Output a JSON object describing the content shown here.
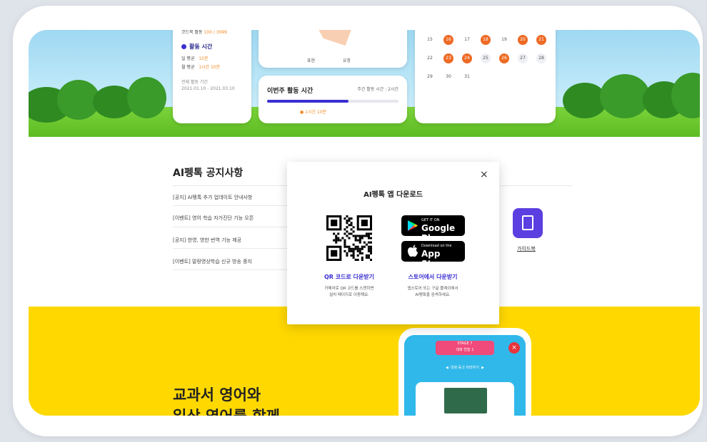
{
  "summary_card": {
    "top_row_label": "코드북 활동",
    "top_row_value": "100 / 3999",
    "section_title": "활동 시간",
    "daily_avg_label": "일 평균",
    "daily_avg_value": "15분",
    "monthly_avg_label": "월 평균",
    "monthly_avg_value": "1시간 10분",
    "period_label": "전체 활동 기간",
    "period_value": "2021.01.10 - 2021.03.10"
  },
  "radar_card": {
    "axis_left": "표현",
    "axis_right": "유창"
  },
  "weekly_card": {
    "title": "이번주 활동 시간",
    "target": "주간 활동 시간 : 2시간",
    "progress": 0.62,
    "current": "1시간 10분"
  },
  "calendar": {
    "weeks": [
      [
        {
          "d": "15",
          "s": "n"
        },
        {
          "d": "16",
          "s": "o"
        },
        {
          "d": "17",
          "s": "n"
        },
        {
          "d": "18",
          "s": "o"
        },
        {
          "d": "19",
          "s": "n"
        },
        {
          "d": "20",
          "s": "o"
        },
        {
          "d": "21",
          "s": "o"
        }
      ],
      [
        {
          "d": "22",
          "s": "n"
        },
        {
          "d": "23",
          "s": "o"
        },
        {
          "d": "24",
          "s": "o"
        },
        {
          "d": "25",
          "s": "g"
        },
        {
          "d": "26",
          "s": "o"
        },
        {
          "d": "27",
          "s": "g"
        },
        {
          "d": "28",
          "s": "g"
        }
      ],
      [
        {
          "d": "29",
          "s": "n"
        },
        {
          "d": "30",
          "s": "n"
        },
        {
          "d": "31",
          "s": "n"
        }
      ]
    ],
    "accent": "#ee6a24"
  },
  "notices": {
    "title": "AI펭톡 공지사항",
    "items": [
      "[공지] AI펭톡 추가 업데이트 안내사항",
      "[이벤트] 영어 학습 자가진단 기능 오픈",
      "[공지] 한영, 영한 번역 기능 제공",
      "[이벤트] 말랑영상학습 신규 방송 중지"
    ]
  },
  "tools": {
    "download_label": "로드",
    "guide_label": "가이드북"
  },
  "promo": {
    "line1": "교과서 영어와",
    "line2": "일상 영어를 함께"
  },
  "modal": {
    "title": "AI펭톡 앱 다운로드",
    "close": "×",
    "google_small": "GET IT ON",
    "google_big": "Google Play",
    "apple_small": "Download on the",
    "apple_big": "App Store",
    "qr_link": "QR 코드로 다운받기",
    "qr_desc1": "카메라로 QR 코드를 스캔하면",
    "qr_desc2": "설치 페이지로 이동해요.",
    "store_link": "스토어에서 다운받기",
    "store_desc1": "앱스토어 또는 구글 플레이에서",
    "store_desc2": "AI펭톡을 검색하세요."
  },
  "phone": {
    "stage": "STAGE 7",
    "stage_title": "대화 연습 1",
    "nav_label": "대화 듣고 따라하기"
  },
  "colors": {
    "primary": "#3b2fd1",
    "accent": "#ee6a24",
    "promo_bg": "#ffd800"
  }
}
